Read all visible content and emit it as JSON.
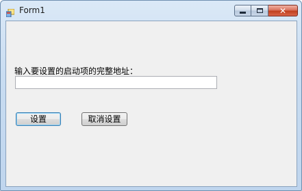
{
  "window": {
    "title": "Form1",
    "caption_buttons": [
      "minimize-icon",
      "maximize-icon",
      "close-icon"
    ]
  },
  "form": {
    "label": "输入要设置的启动项的完整地址：",
    "path_input_value": "",
    "set_button_label": "设置",
    "cancel_button_label": "取消设置"
  },
  "colors": {
    "titlebar": "#c8dcf1",
    "client_background": "#f0f0f0",
    "close_button": "#c0401f"
  }
}
